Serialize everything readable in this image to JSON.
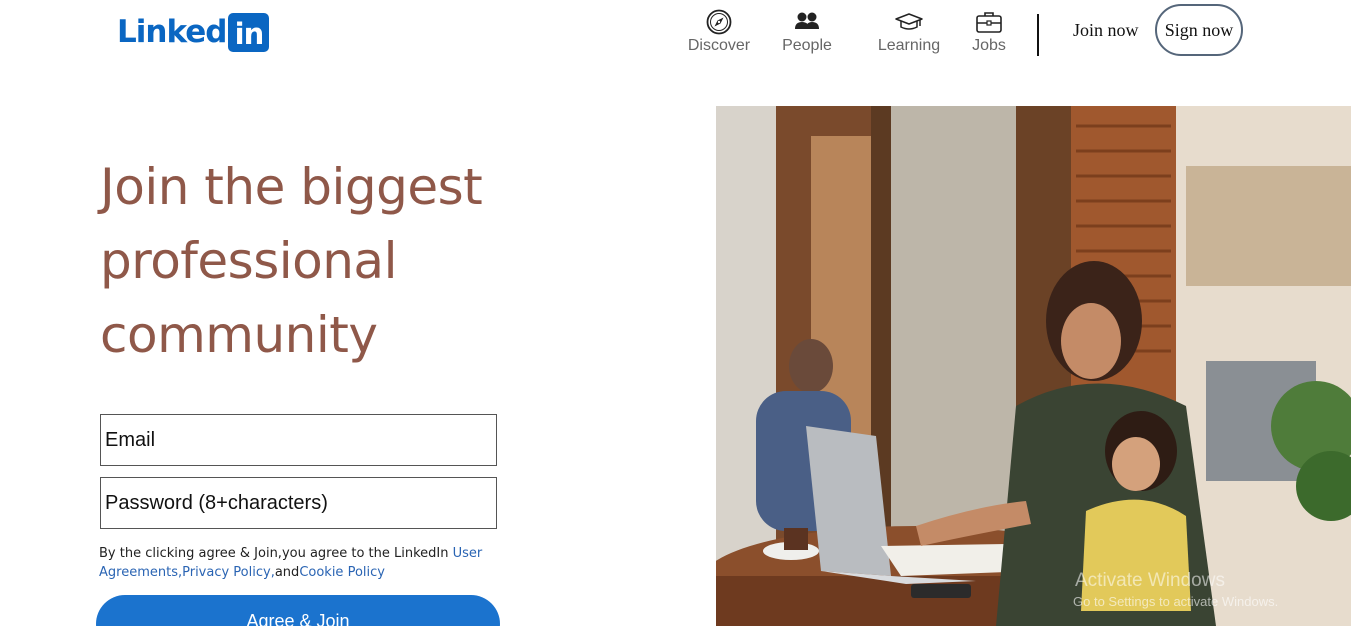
{
  "brand": {
    "logo_text": "Linked",
    "logo_box": "in"
  },
  "nav": {
    "items": [
      {
        "label": "Discover",
        "icon": "compass-icon"
      },
      {
        "label": "People",
        "icon": "people-icon"
      },
      {
        "label": "Learning",
        "icon": "graduation-cap-icon"
      },
      {
        "label": "Jobs",
        "icon": "briefcase-icon"
      }
    ],
    "join_label": "Join now",
    "sign_label": "Sign now"
  },
  "hero": {
    "headline": [
      "Join the biggest",
      "professional",
      "community"
    ]
  },
  "form": {
    "email_placeholder": "Email",
    "password_placeholder": "Password (8+characters)",
    "terms_prefix": "By the clicking agree & Join,you agree to the LinkedIn ",
    "terms_link_user_agreements": "User Agreements,",
    "terms_link_privacy": "Privacy Policy,",
    "terms_and": "and",
    "terms_link_cookie": "Cookie Policy",
    "submit_label": "Agree & Join"
  },
  "os_watermark": {
    "title": "Activate Windows",
    "subtitle": "Go to Settings to activate Windows."
  },
  "colors": {
    "brand_blue": "#0a66c2",
    "headline": "#8f5849",
    "button_blue": "#1b73ce",
    "link": "#2a64b3"
  }
}
